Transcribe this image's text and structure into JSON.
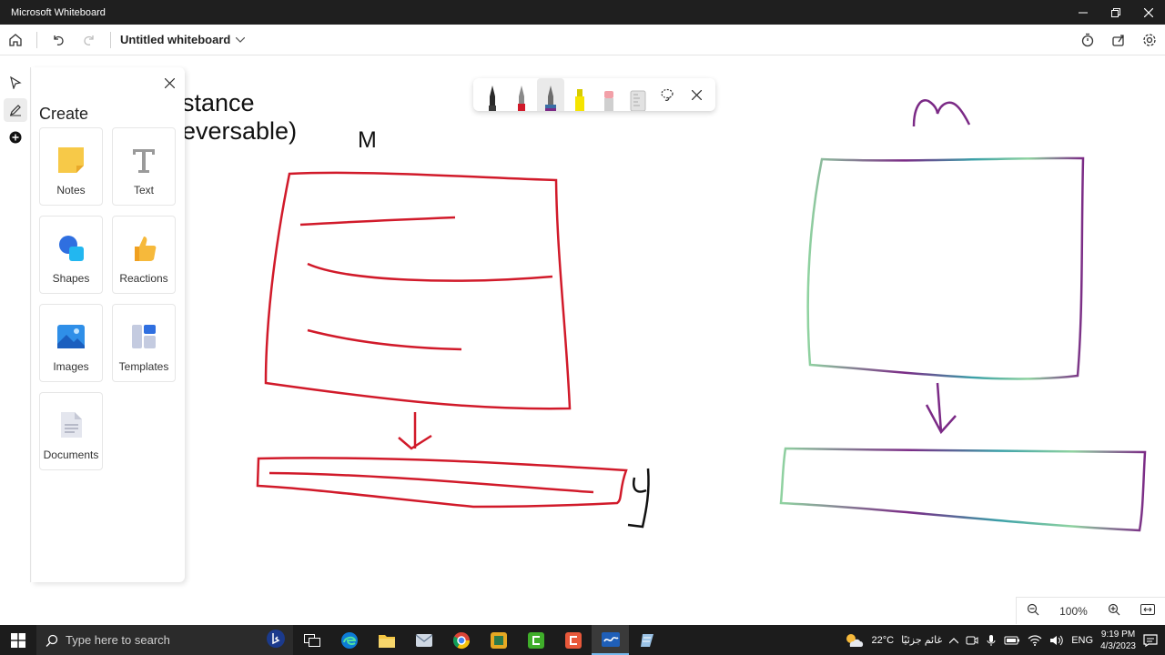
{
  "window": {
    "title": "Microsoft Whiteboard"
  },
  "topbar": {
    "board_title": "Untitled whiteboard"
  },
  "create_panel": {
    "heading": "Create",
    "tiles": [
      {
        "label": "Notes",
        "icon": "notes-icon"
      },
      {
        "label": "Text",
        "icon": "text-icon"
      },
      {
        "label": "Shapes",
        "icon": "shapes-icon"
      },
      {
        "label": "Reactions",
        "icon": "reactions-icon"
      },
      {
        "label": "Images",
        "icon": "images-icon"
      },
      {
        "label": "Templates",
        "icon": "templates-icon"
      },
      {
        "label": "Documents",
        "icon": "documents-icon"
      }
    ]
  },
  "canvas": {
    "text_line1": "stance",
    "text_line2": "eversable)",
    "label_m": "M"
  },
  "pen_toolbar": {
    "pens": [
      {
        "name": "black-pen",
        "color": "#222222"
      },
      {
        "name": "red-pen",
        "color": "#d11a2a"
      },
      {
        "name": "galaxy-pen",
        "color": "#3a6ea5"
      },
      {
        "name": "yellow-highlighter",
        "color": "#f5e400"
      },
      {
        "name": "eraser",
        "color": "#f2a0a8"
      },
      {
        "name": "ruler",
        "color": "#bdbdbd"
      }
    ]
  },
  "zoom": {
    "level": "100%"
  },
  "taskbar": {
    "search_placeholder": "Type here to search",
    "weather": "22°C",
    "weather_desc": "غائم جزئيًا",
    "language": "ENG",
    "time": "9:19 PM",
    "date": "4/3/2023"
  },
  "colors": {
    "ink_red": "#d11a2a",
    "ink_purple": "#7b2a86",
    "ink_teal": "#3aa0a8",
    "ink_green": "#8fd3a0"
  }
}
